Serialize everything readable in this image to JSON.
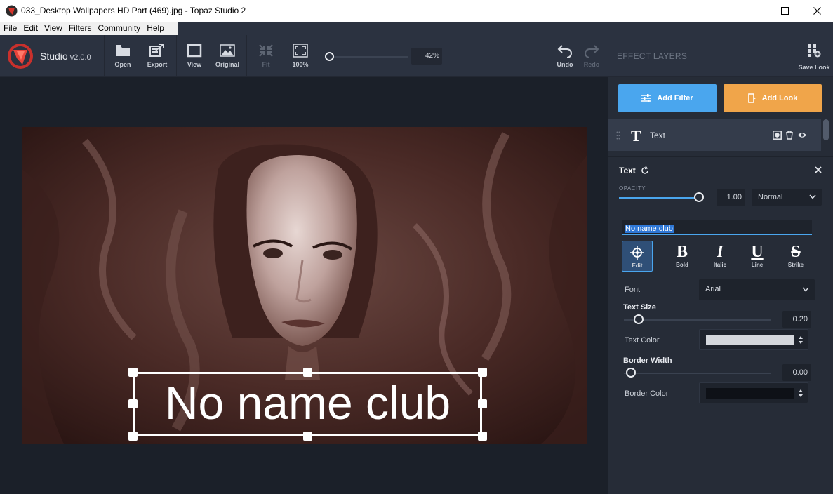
{
  "window": {
    "title": "033_Desktop Wallpapers  HD Part (469).jpg - Topaz Studio 2"
  },
  "menu": [
    "File",
    "Edit",
    "View",
    "Filters",
    "Community",
    "Help"
  ],
  "brand": {
    "name": "Studio",
    "version": "v2.0.0"
  },
  "toolbar": {
    "open": "Open",
    "export": "Export",
    "view": "View",
    "original": "Original",
    "fit": "Fit",
    "hundred": "100%",
    "zoom": "42%",
    "undo": "Undo",
    "redo": "Redo"
  },
  "canvas": {
    "overlay_text": "No name club"
  },
  "panel": {
    "title": "EFFECT LAYERS",
    "save_look": "Save Look",
    "add_filter": "Add Filter",
    "add_look": "Add Look",
    "layer": {
      "name": "Text",
      "icon": "T"
    },
    "section": {
      "title": "Text",
      "opacity_label": "OPACITY",
      "opacity_value": "1.00",
      "opacity_level": 1.0,
      "blend_mode": "Normal",
      "text_value": "No name club",
      "format": [
        {
          "glyph": "⌖",
          "label": "Edit"
        },
        {
          "glyph": "B",
          "label": "Bold"
        },
        {
          "glyph": "I",
          "label": "Italic"
        },
        {
          "glyph": "U",
          "label": "Line"
        },
        {
          "glyph": "S",
          "label": "Strike"
        }
      ],
      "font_label": "Font",
      "font_value": "Arial",
      "text_size_label": "Text Size",
      "text_size_value": "0.20",
      "text_size_level": 0.2,
      "text_color_label": "Text Color",
      "text_color": "#d4d7dc",
      "border_width_label": "Border Width",
      "border_width_value": "0.00",
      "border_width_level": 0.0,
      "border_color_label": "Border Color",
      "border_color": "#0e1117"
    }
  },
  "colors": {
    "accent_blue": "#4aa6ee",
    "accent_orange": "#f0a54a",
    "bg_dark": "#1b2029",
    "panel_bg": "#262c37"
  }
}
